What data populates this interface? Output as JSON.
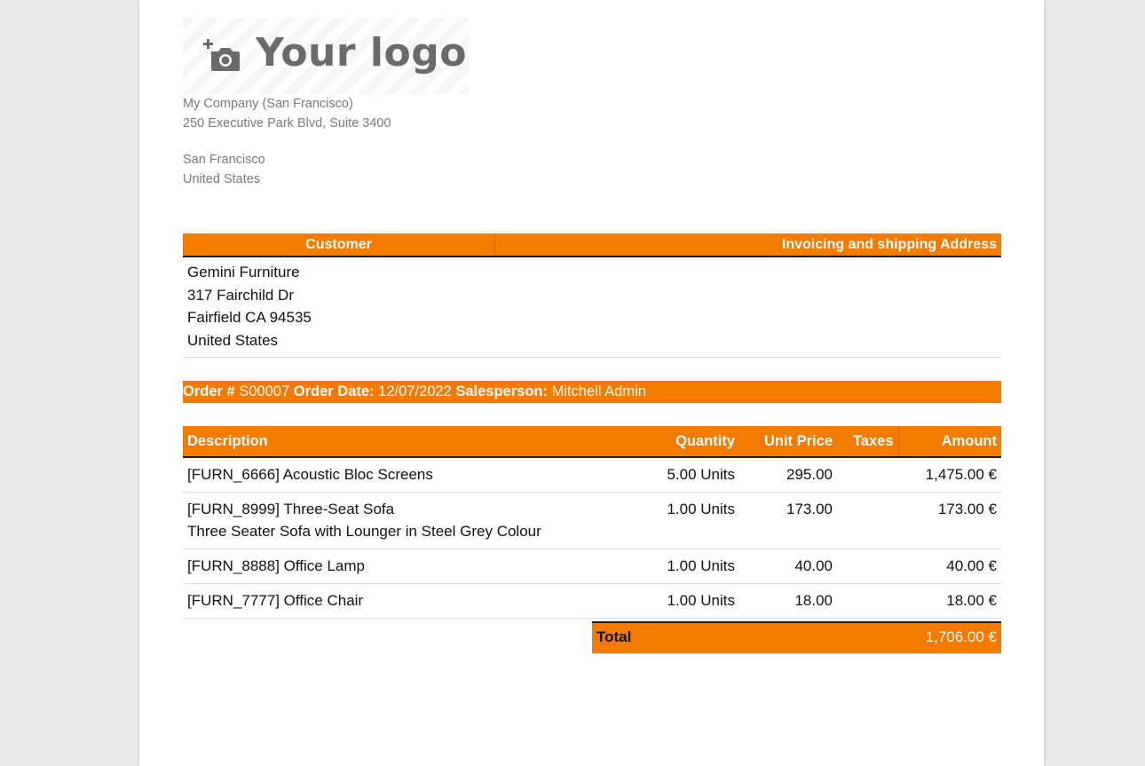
{
  "logo": {
    "icon": "add-photo-camera-icon",
    "text": "Your logo"
  },
  "company": {
    "name": "My Company (San Francisco)",
    "street": "250 Executive Park Blvd, Suite 3400",
    "city": "San Francisco",
    "country": "United States"
  },
  "customer_section": {
    "header_customer": "Customer",
    "header_address": "Invoicing and shipping Address",
    "customer": {
      "name": "Gemini Furniture",
      "street": "317 Fairchild Dr",
      "city_zip": "Fairfield CA 94535",
      "country": "United States"
    }
  },
  "order": {
    "number_label": "Order #",
    "number": "S00007",
    "date_label": "Order Date:",
    "date": "12/07/2022",
    "salesperson_label": "Salesperson:",
    "salesperson": "Mitchell Admin"
  },
  "lines_table": {
    "headers": {
      "description": "Description",
      "quantity": "Quantity",
      "unit_price": "Unit Price",
      "taxes": "Taxes",
      "amount": "Amount"
    },
    "rows": [
      {
        "description": "[FURN_6666] Acoustic Bloc Screens",
        "note": "",
        "quantity": "5.00 Units",
        "unit_price": "295.00",
        "taxes": "",
        "amount": "1,475.00 €"
      },
      {
        "description": "[FURN_8999] Three-Seat Sofa",
        "note": "Three Seater Sofa with Lounger in Steel Grey Colour",
        "quantity": "1.00 Units",
        "unit_price": "173.00",
        "taxes": "",
        "amount": "173.00 €"
      },
      {
        "description": "[FURN_8888] Office Lamp",
        "note": "",
        "quantity": "1.00 Units",
        "unit_price": "40.00",
        "taxes": "",
        "amount": "40.00 €"
      },
      {
        "description": "[FURN_7777] Office Chair",
        "note": "",
        "quantity": "1.00 Units",
        "unit_price": "18.00",
        "taxes": "",
        "amount": "18.00 €"
      }
    ]
  },
  "totals": {
    "label": "Total",
    "value": "1,706.00 €"
  },
  "colors": {
    "accent": "#f47a00",
    "rule": "#1e1e1e",
    "company_text": "#7a7a7a",
    "body_text": "#111111"
  }
}
